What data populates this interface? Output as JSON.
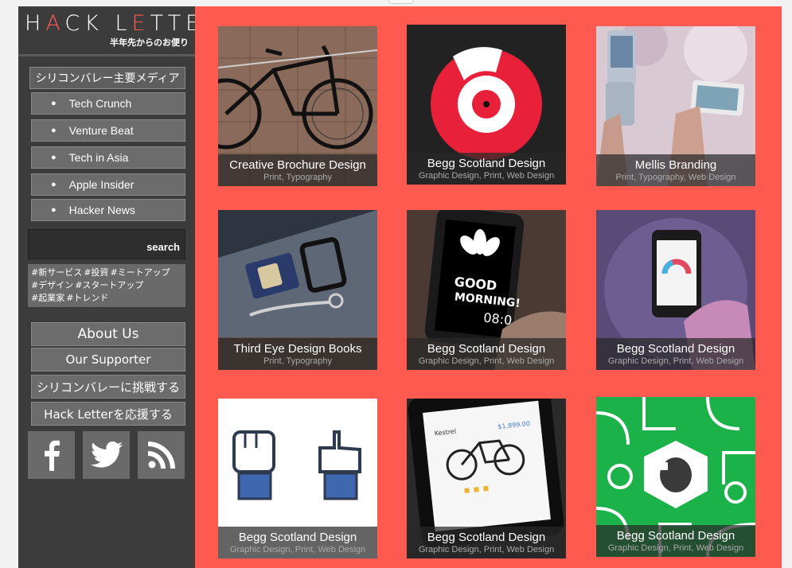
{
  "logo": {
    "title_pre": "H",
    "title_a": "A",
    "title_post": "CK L",
    "title_e": "E",
    "title_end": "TTER",
    "subtitle": "半年先からのお便り"
  },
  "sidebar": {
    "section_title": "シリコンバレー主要メディア",
    "media": [
      {
        "label": "Tech Crunch"
      },
      {
        "label": "Venture Beat"
      },
      {
        "label": "Tech in Asia"
      },
      {
        "label": "Apple Insider"
      },
      {
        "label": "Hacker News"
      }
    ],
    "search_label": "search",
    "tags": [
      "#新サービス",
      "#投資",
      "#ミートアップ",
      "#デザイン",
      "#スタートアップ",
      "#起業家",
      "#トレンド"
    ],
    "links": [
      {
        "label": "About Us"
      },
      {
        "label": "Our Supporter"
      },
      {
        "label": "シリコンバレーに挑戦する"
      },
      {
        "label": "Hack Letterを応援する"
      }
    ],
    "social": [
      "facebook-icon",
      "twitter-icon",
      "rss-icon"
    ]
  },
  "colors": {
    "accent": "#ff5a50",
    "sidebar": "#3c3c3c"
  },
  "cards": [
    {
      "title": "Creative Brochure Design",
      "tags": "Print, Typography"
    },
    {
      "title": "Begg Scotland Design",
      "tags": "Graphic Design, Print, Web Design"
    },
    {
      "title": "Mellis Branding",
      "tags": "Print, Typography, Web Design"
    },
    {
      "title": "Third Eye Design Books",
      "tags": "Print, Typography"
    },
    {
      "title": "Begg Scotland Design",
      "tags": "Graphic Design, Print, Web Design"
    },
    {
      "title": "Begg Scotland Design",
      "tags": "Graphic Design, Print, Web Design"
    },
    {
      "title": "Begg Scotland Design",
      "tags": "Graphic Design, Print, Web Design"
    },
    {
      "title": "Begg Scotland Design",
      "tags": "Graphic Design, Print, Web Design"
    },
    {
      "title": "Begg Scotland Design",
      "tags": "Graphic Design, Print, Web Design"
    }
  ],
  "card_images": {
    "phone_text_1": "GOOD",
    "phone_text_2": "MORNING!",
    "phone_clock": "08:0",
    "bike_app_price": "$1,899.00",
    "bike_app_title": "Kestrel"
  }
}
